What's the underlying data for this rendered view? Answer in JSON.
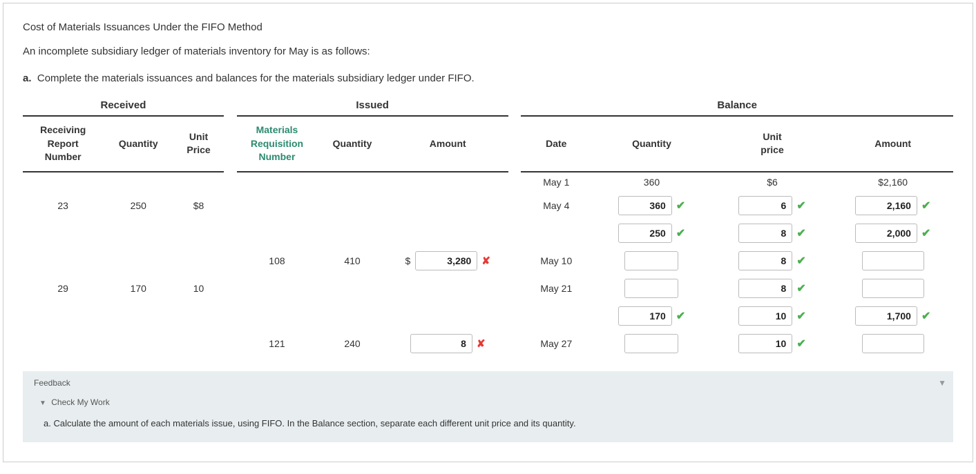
{
  "title": "Cost of Materials Issuances Under the FIFO Method",
  "subtitle": "An incomplete subsidiary ledger of materials inventory for May is as follows:",
  "instruction_prefix": "a.",
  "instruction": "Complete the materials issuances and balances for the materials subsidiary ledger under FIFO.",
  "sections": {
    "received": "Received",
    "issued": "Issued",
    "balance": "Balance"
  },
  "cols": {
    "receiving_report_number": "Receiving Report Number",
    "recv_qty": "Quantity",
    "unit_price": "Unit Price",
    "materials_req_number": "Materials Requisition Number",
    "iss_qty": "Quantity",
    "iss_amount": "Amount",
    "date": "Date",
    "bal_qty": "Quantity",
    "bal_unit_price": "Unit price",
    "bal_amount": "Amount"
  },
  "rows": {
    "r0": {
      "date": "May 1",
      "bal_qty": "360",
      "bal_unit_price": "$6",
      "bal_amount": "$2,160"
    },
    "r1": {
      "recv_no": "23",
      "recv_qty": "250",
      "recv_price": "$8",
      "date": "May 4",
      "bal_qty_inp": "360",
      "bal_up_inp": "6",
      "bal_amt_inp": "2,160"
    },
    "r1b": {
      "bal_qty_inp": "250",
      "bal_up_inp": "8",
      "bal_amt_inp": "2,000"
    },
    "r2": {
      "req_no": "108",
      "iss_qty": "410",
      "iss_amt_inp": "3,280",
      "date": "May 10",
      "bal_qty_inp": "",
      "bal_up_inp": "8",
      "bal_amt_inp": ""
    },
    "r3": {
      "recv_no": "29",
      "recv_qty": "170",
      "recv_price": "10",
      "date": "May 21",
      "bal_qty_inp": "",
      "bal_up_inp": "8",
      "bal_amt_inp": ""
    },
    "r3b": {
      "bal_qty_inp": "170",
      "bal_up_inp": "10",
      "bal_amt_inp": "1,700"
    },
    "r4": {
      "req_no": "121",
      "iss_qty": "240",
      "iss_amt_inp": "8",
      "date": "May 27",
      "bal_qty_inp": "",
      "bal_up_inp": "10",
      "bal_amt_inp": ""
    }
  },
  "feedback": {
    "header": "Feedback",
    "check_my_work": "Check My Work",
    "body": "a. Calculate the amount of each materials issue, using FIFO. In the Balance section, separate each different unit price and its quantity."
  },
  "marks": {
    "correct": "✔",
    "wrong": "✘"
  },
  "glyphs": {
    "chevron_down": "▼",
    "arrow": "▼"
  }
}
